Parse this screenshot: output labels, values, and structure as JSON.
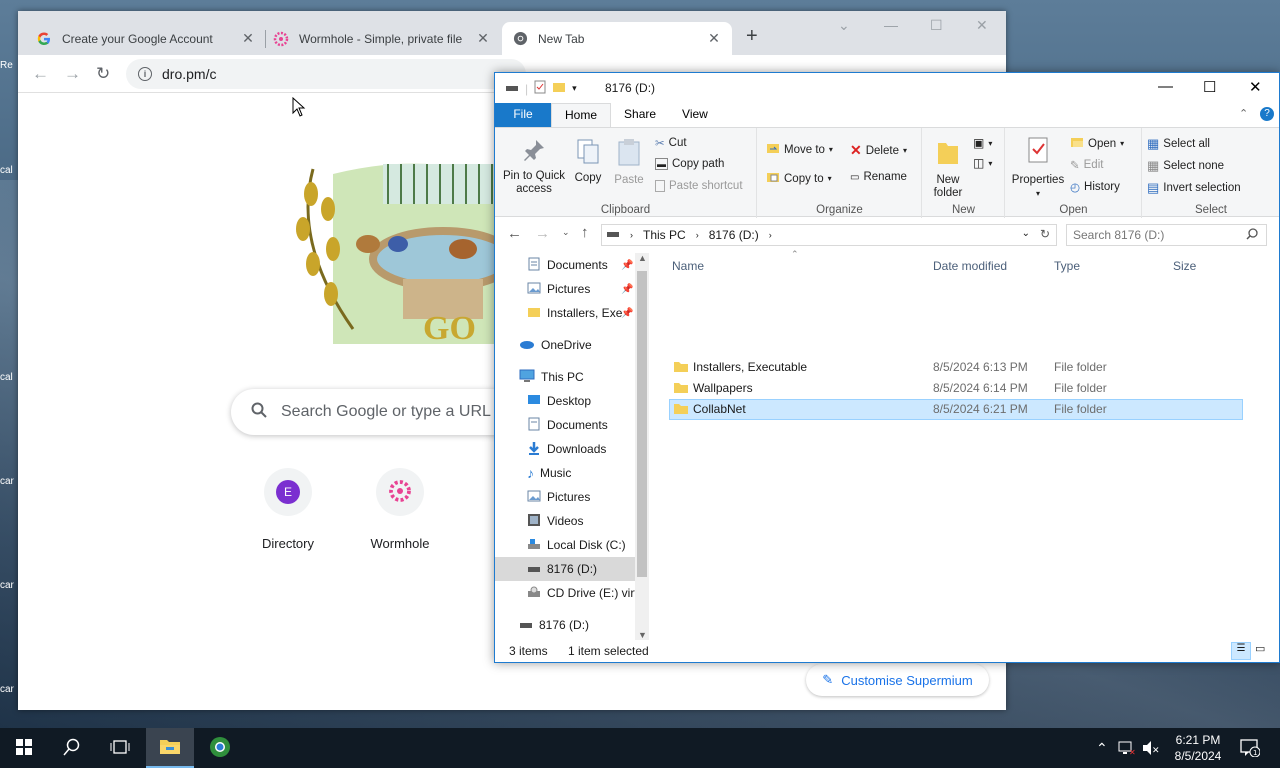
{
  "desktop": {
    "icons": [
      "Re",
      "cal",
      "cal",
      "car",
      "car",
      "car"
    ]
  },
  "chrome": {
    "tabs": [
      {
        "title": "Create your Google Account",
        "icon": "google-g-icon"
      },
      {
        "title": "Wormhole - Simple, private file",
        "icon": "wormhole-icon"
      },
      {
        "title": "New Tab",
        "icon": "chrome-icon"
      }
    ],
    "url": "dro.pm/c",
    "search_placeholder": "Search Google or type a URL",
    "shortcuts": [
      {
        "label": "Directory",
        "letter": "E"
      },
      {
        "label": "Wormhole",
        "letter": ""
      }
    ],
    "customise_label": "Customise Supermium",
    "doodle_text": "GO"
  },
  "explorer": {
    "title": "8176 (D:)",
    "ribbon_tabs": [
      "File",
      "Home",
      "Share",
      "View"
    ],
    "clipboard": {
      "pin": "Pin to Quick access",
      "copy": "Copy",
      "paste": "Paste",
      "cut": "Cut",
      "copy_path": "Copy path",
      "paste_shortcut": "Paste shortcut",
      "label": "Clipboard"
    },
    "organize": {
      "move_to": "Move to",
      "copy_to": "Copy to",
      "delete": "Delete",
      "rename": "Rename",
      "label": "Organize"
    },
    "new": {
      "new_folder": "New folder",
      "label": "New"
    },
    "open": {
      "properties": "Properties",
      "open": "Open",
      "edit": "Edit",
      "history": "History",
      "label": "Open"
    },
    "select": {
      "select_all": "Select all",
      "select_none": "Select none",
      "invert": "Invert selection",
      "label": "Select"
    },
    "breadcrumb": [
      "This PC",
      "8176 (D:)"
    ],
    "search_placeholder": "Search 8176 (D:)",
    "nav": [
      {
        "label": "Documents",
        "pinned": true,
        "icon": "documents-icon"
      },
      {
        "label": "Pictures",
        "pinned": true,
        "icon": "pictures-icon"
      },
      {
        "label": "Installers, Exe",
        "pinned": true,
        "icon": "folder-icon"
      },
      {
        "label": "OneDrive",
        "icon": "onedrive-icon"
      },
      {
        "label": "This PC",
        "icon": "pc-icon"
      },
      {
        "label": "Desktop",
        "icon": "desktop-icon"
      },
      {
        "label": "Documents",
        "icon": "documents-icon"
      },
      {
        "label": "Downloads",
        "icon": "downloads-icon"
      },
      {
        "label": "Music",
        "icon": "music-icon"
      },
      {
        "label": "Pictures",
        "icon": "pictures-icon"
      },
      {
        "label": "Videos",
        "icon": "videos-icon"
      },
      {
        "label": "Local Disk (C:)",
        "icon": "disk-icon"
      },
      {
        "label": "8176 (D:)",
        "icon": "drive-icon"
      },
      {
        "label": "CD Drive (E:) virt",
        "icon": "cd-icon"
      },
      {
        "label": "8176 (D:)",
        "icon": "drive-icon"
      }
    ],
    "columns": {
      "name": "Name",
      "date": "Date modified",
      "type": "Type",
      "size": "Size"
    },
    "files": [
      {
        "name": "Installers, Executable",
        "date": "8/5/2024 6:13 PM",
        "type": "File folder"
      },
      {
        "name": "Wallpapers",
        "date": "8/5/2024 6:14 PM",
        "type": "File folder"
      },
      {
        "name": "CollabNet",
        "date": "8/5/2024 6:21 PM",
        "type": "File folder"
      }
    ],
    "status": {
      "items": "3 items",
      "selected": "1 item selected"
    }
  },
  "taskbar": {
    "time": "6:21 PM",
    "date": "8/5/2024",
    "notification_count": "1"
  },
  "colors": {
    "accent": "#1979ca",
    "selection": "#cce8ff",
    "chrome_tabstrip": "#dee1e6"
  }
}
